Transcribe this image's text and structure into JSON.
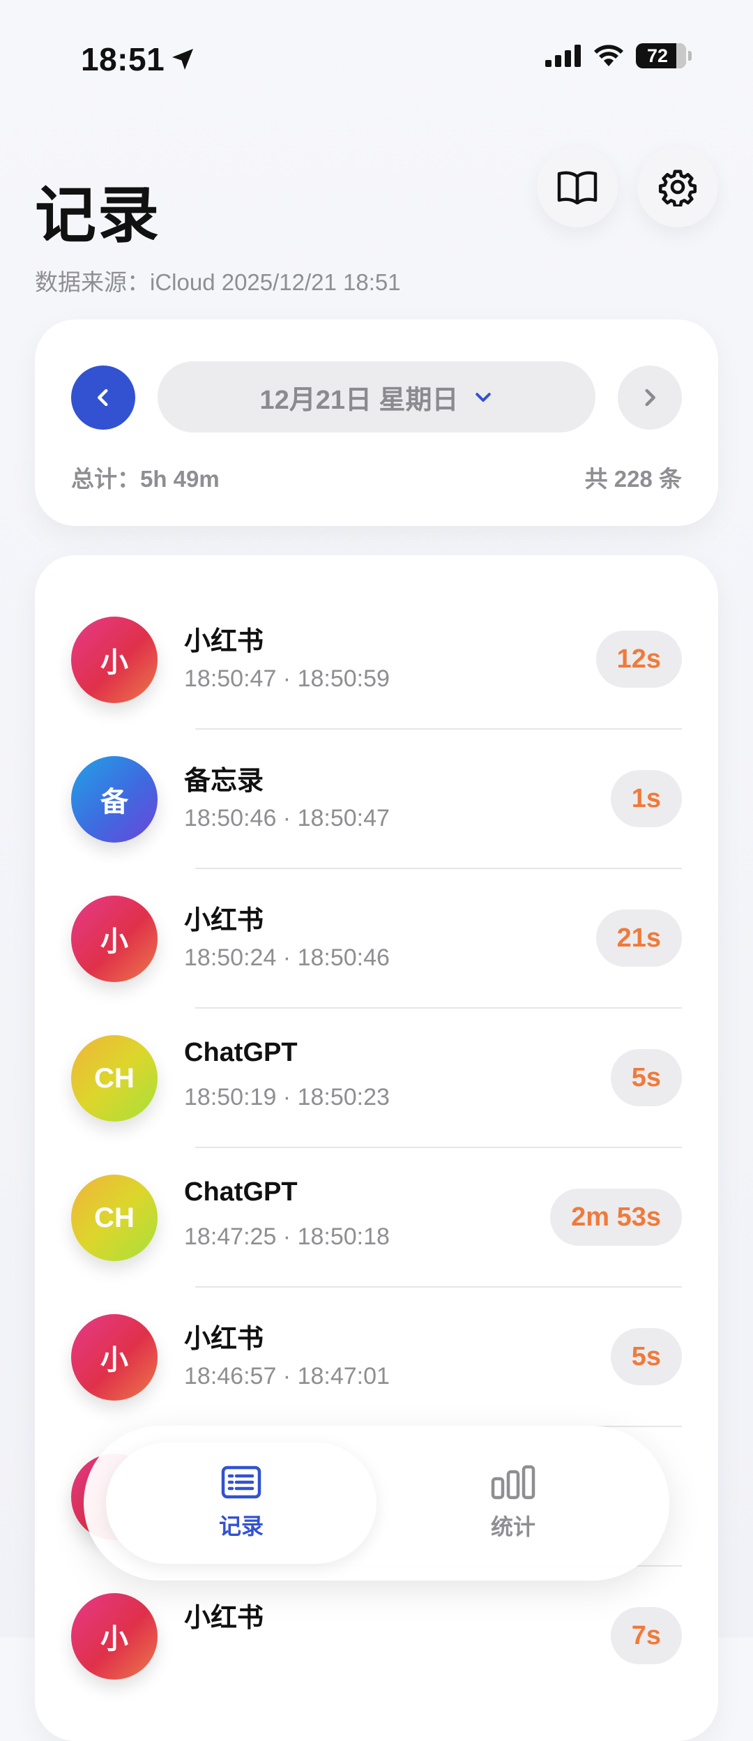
{
  "status_bar": {
    "time": "18:51",
    "battery": "72"
  },
  "header": {
    "title": "记录",
    "subtitle": "数据来源：iCloud  2025/12/21 18:51",
    "book_icon": "book-icon",
    "settings_icon": "gear-icon"
  },
  "date_nav": {
    "date_label": "12月21日 星期日",
    "total_label": "总计：5h 49m",
    "count_label": "共 228 条"
  },
  "records": [
    {
      "name": "小红书",
      "avatar": "小",
      "range": "18:50:47 · 18:50:59",
      "duration": "12s",
      "color": "red"
    },
    {
      "name": "备忘录",
      "avatar": "备",
      "range": "18:50:46 · 18:50:47",
      "duration": "1s",
      "color": "blue"
    },
    {
      "name": "小红书",
      "avatar": "小",
      "range": "18:50:24 · 18:50:46",
      "duration": "21s",
      "color": "red"
    },
    {
      "name": "ChatGPT",
      "avatar": "CH",
      "range": "18:50:19 · 18:50:23",
      "duration": "5s",
      "color": "yellow"
    },
    {
      "name": "ChatGPT",
      "avatar": "CH",
      "range": "18:47:25 · 18:50:18",
      "duration": "2m 53s",
      "color": "yellow"
    },
    {
      "name": "小红书",
      "avatar": "小",
      "range": "18:46:57 · 18:47:01",
      "duration": "5s",
      "color": "red"
    },
    {
      "name": "",
      "avatar": "",
      "range": "",
      "duration": "",
      "color": "red"
    },
    {
      "name": "小红书",
      "avatar": "小",
      "range": "",
      "duration": "7s",
      "color": "red"
    }
  ],
  "tabs": {
    "records_label": "记录",
    "stats_label": "统计"
  },
  "colors": {
    "accent": "#3352d1",
    "duration": "#f07a3a",
    "muted": "#8e8e93"
  }
}
